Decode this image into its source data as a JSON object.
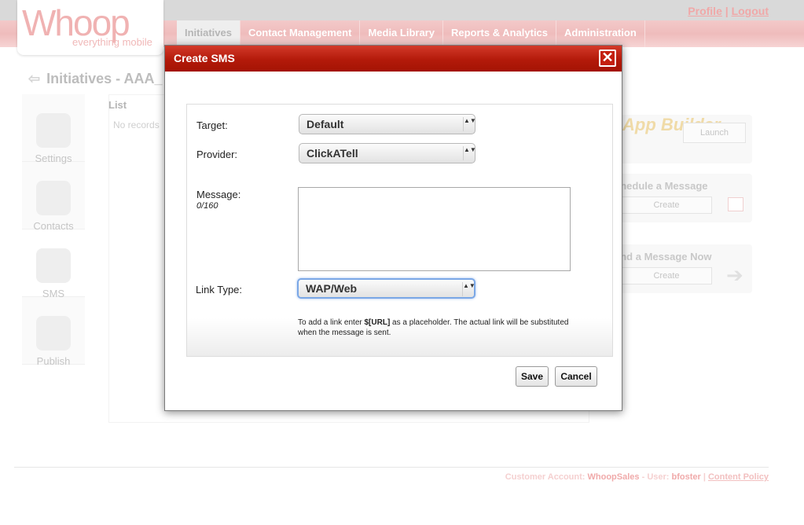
{
  "app": {
    "logo_main": "Whoop",
    "logo_sub": "everything mobile"
  },
  "header": {
    "profile": "Profile",
    "separator": "|",
    "logout": "Logout"
  },
  "tabs": [
    {
      "label": "Initiatives"
    },
    {
      "label": "Contact Management"
    },
    {
      "label": "Media Library"
    },
    {
      "label": "Reports & Analytics"
    },
    {
      "label": "Administration"
    }
  ],
  "page": {
    "title": "Initiatives - AAA_",
    "list_heading": "List",
    "no_records": "No records"
  },
  "sidenav": [
    {
      "label": "Settings"
    },
    {
      "label": "Contacts"
    },
    {
      "label": "SMS"
    },
    {
      "label": "Publish"
    }
  ],
  "cards": {
    "app_builder_logo": "App Builder",
    "launch_label": "Launch",
    "schedule_title": "chedule a Message",
    "schedule_create": "Create",
    "send_title": "end a Message Now",
    "send_create": "Create"
  },
  "footer": {
    "customer_account_label": "Customer Account:",
    "customer_account": "WhoopSales",
    "user_label": "- User:",
    "user": "bfoster",
    "separator": "|",
    "content_policy": "Content Policy"
  },
  "modal": {
    "title": "Create SMS",
    "close_glyph": "✕",
    "target_label": "Target:",
    "target_value": "Default",
    "provider_label": "Provider:",
    "provider_value": "ClickATell",
    "message_label": "Message:",
    "message_count": "0/160",
    "message_value": "",
    "link_type_label": "Link Type:",
    "link_type_value": "WAP/Web",
    "hint_prefix": "To add a link enter ",
    "hint_placeholder": "$[URL]",
    "hint_suffix": " as a placeholder. The actual link will be substituted when the message is sent.",
    "save_label": "Save",
    "cancel_label": "Cancel"
  },
  "icons": {
    "select_arrows": "▲▼",
    "back_arrow": "⇦"
  },
  "colors": {
    "modal_header": "#b31a0a",
    "tab_bar": "#efbcbc",
    "focus_ring": "#7aa7e6"
  }
}
